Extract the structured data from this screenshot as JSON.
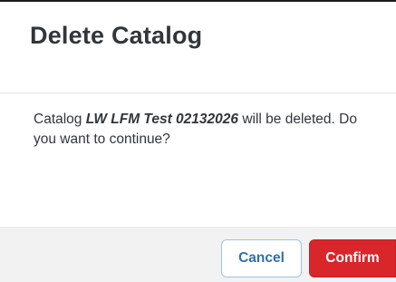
{
  "dialog": {
    "title": "Delete Catalog",
    "message": {
      "prefix": "Catalog ",
      "catalog_name": "LW LFM Test 02132026",
      "suffix": " will be deleted. Do you want to continue?"
    },
    "buttons": {
      "cancel_label": "Cancel",
      "confirm_label": "Confirm"
    }
  },
  "colors": {
    "title_text": "#32363a",
    "cancel_text": "#2f6fb0",
    "cancel_border": "#9cc3e8",
    "confirm_background": "#d9262b",
    "footer_background": "#f2f2f2"
  }
}
